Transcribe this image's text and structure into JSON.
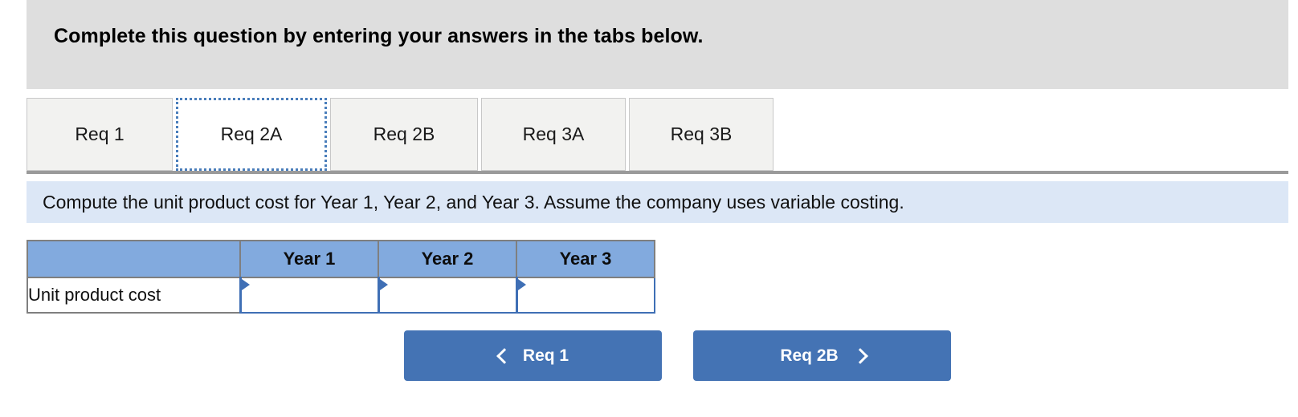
{
  "banner": {
    "title": "Complete this question by entering your answers in the tabs below."
  },
  "tabs": [
    {
      "label": "Req 1",
      "selected": false
    },
    {
      "label": "Req 2A",
      "selected": true
    },
    {
      "label": "Req 2B",
      "selected": false
    },
    {
      "label": "Req 3A",
      "selected": false
    },
    {
      "label": "Req 3B",
      "selected": false
    }
  ],
  "instruction": {
    "text": "Compute the unit product cost for Year 1, Year 2, and Year 3. Assume the company uses variable costing."
  },
  "table": {
    "headers": [
      "",
      "Year 1",
      "Year 2",
      "Year 3"
    ],
    "rows": [
      {
        "label": "Unit product cost",
        "values": [
          "",
          "",
          ""
        ]
      }
    ]
  },
  "nav": {
    "prev_label": "Req 1",
    "next_label": "Req 2B",
    "prev_icon": "chevron-left-icon",
    "next_icon": "chevron-right-icon"
  },
  "colors": {
    "banner_bg": "#dedede",
    "instruction_bg": "#dce7f6",
    "table_header_bg": "#82aade",
    "button_bg": "#4473b4",
    "tab_focus_border": "#4a7ebb",
    "cell_border": "#3f6fb5"
  }
}
